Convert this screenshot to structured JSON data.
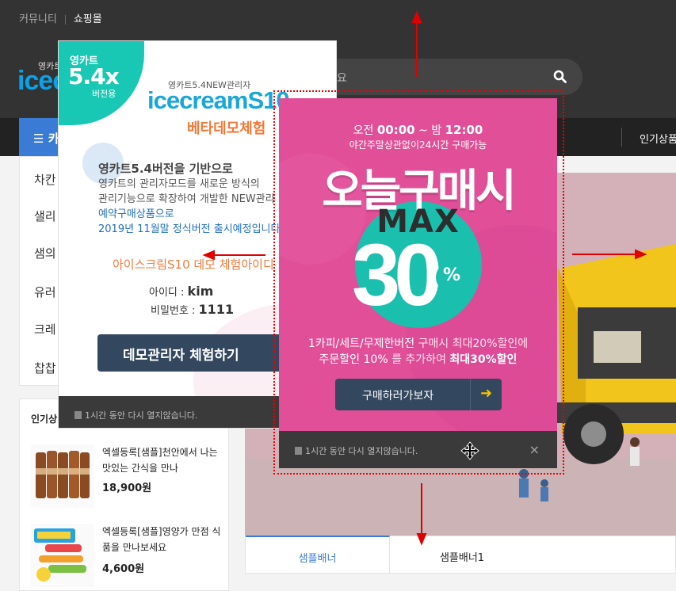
{
  "topbar": {
    "community": "커뮤니티",
    "shopping": "쇼핑몰"
  },
  "header": {
    "logo_small": "영카트",
    "logo_big": "icec",
    "search_placeholder": "세요"
  },
  "nav": {
    "category_label": "카",
    "popular_label": "인기상품"
  },
  "sidebar": {
    "items": [
      "차칸",
      "샐리",
      "샘의",
      "유러",
      "크레",
      "찹찹"
    ]
  },
  "popular_box": {
    "title": "인기상",
    "products": [
      {
        "name": "엑셀등록[샘플]천안에서 나는 맛있는 간식을 만나",
        "price": "18,900원"
      },
      {
        "name": "엑셀등록[샘플]영양가 만점 식품을 만나보세요",
        "price": "4,600원"
      }
    ]
  },
  "banner": {
    "tabs": [
      "샘플배너",
      "샘플배너1"
    ]
  },
  "popup1": {
    "ver_line1": "영카트",
    "ver_line2": "5.4x",
    "ver_line3": "버전용",
    "subtitle": "영카트5.4NEW관리자",
    "brand": "icecreamS10",
    "brand_sub": "베타데모체험",
    "desc_lead": "영카트5.4버전을 기반으로",
    "desc_line2": "영카트의 관리자모드를 새로운 방식의",
    "desc_line3": "관리기능으로 확장하여 개발한 NEW관리",
    "desc_line4": "예약구매상품으로",
    "desc_line5": "2019년 11월말 정식버전 출시예정입니다",
    "demo_label": "아이스크림S10 데모 체험아이디",
    "id_label": "아이디 :",
    "id_value": "kim",
    "pw_label": "비밀번호 :",
    "pw_value": "1111",
    "button_label": "데모관리자 체험하기",
    "footer_text": "1시간 동안 다시 열지않습니다."
  },
  "popup2": {
    "time_prefix": "오전",
    "time_start": "00:00",
    "time_mid": "~ 밤",
    "time_end": "12:00",
    "sub": "야간주말상관없이24시간 구매가능",
    "headline": "오늘구매시",
    "max": "MAX",
    "percent_value": "30",
    "percent_sign": "%",
    "info_line1_a": "1카피/세트/무제한버전",
    "info_line1_b": "구매시 최대20%할인에",
    "info_line2_a": "주문할인 10%",
    "info_line2_b": "를 추가하여",
    "info_line2_c": "최대30%할인",
    "button_label": "구매하러가보자",
    "button_arrow": "➜",
    "footer_text": "1시간 동안 다시 열지않습니다.",
    "close": "×"
  },
  "colors": {
    "accent": "#3a7bd5",
    "popup_pink": "#e04f98",
    "teal": "#1bbfae",
    "button_navy": "#33475e",
    "guide_red": "#e00000"
  }
}
